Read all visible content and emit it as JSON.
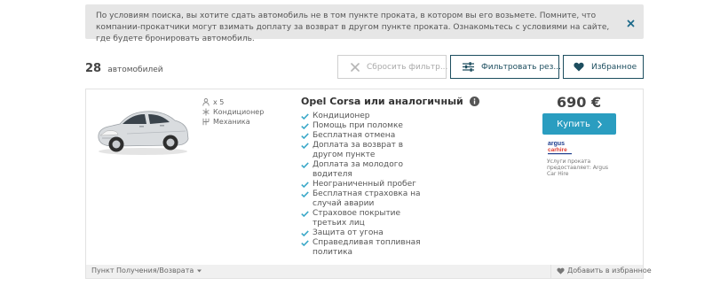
{
  "notice": {
    "text": "По условиям поиска, вы хотите сдать автомобиль не в том пункте проката, в котором вы его возьмете. Помните, что компании-прокатчики могут взимать доплату за возврат в другом пункте проката. Ознакомьтесь с условиями на сайте, где будете бронировать автомобиль.",
    "close_icon": "close-icon"
  },
  "results": {
    "count": "28",
    "count_label": "автомобилей"
  },
  "toolbar": {
    "reset_label": "Сбросить фильтр...",
    "filter_label": "Фильтровать рез...",
    "favorites_label": "Избранное"
  },
  "car": {
    "specs": {
      "seats": "x 5",
      "ac": "Кондиционер",
      "transmission": "Механика"
    },
    "title": "Opel Corsa или аналогичный",
    "features": [
      "Кондиционер",
      "Помощь при поломке",
      "Бесплатная отмена",
      "Доплата за возврат в другом пункте",
      "Доплата за молодого водителя",
      "Неограниченный пробег",
      "Бесплатная страховка на случай аварии",
      "Страховое покрытие третьих лиц",
      "Защита от угона",
      "Справедливая топливная политика"
    ],
    "price": "690 €",
    "buy_label": "Купить",
    "supplier_logo": "argus carhire",
    "supplier_text": "Услуги проката предоставляет: Argus Car Hire",
    "pickup_label": "Пункт Получения/Возврата",
    "add_favorite_label": "Добавить в избранное"
  },
  "colors": {
    "accent_dark": "#1d4e5f",
    "buy_button": "#2a9dc0",
    "check": "#3aa8c8",
    "notice_bg": "#e6e6e6"
  }
}
